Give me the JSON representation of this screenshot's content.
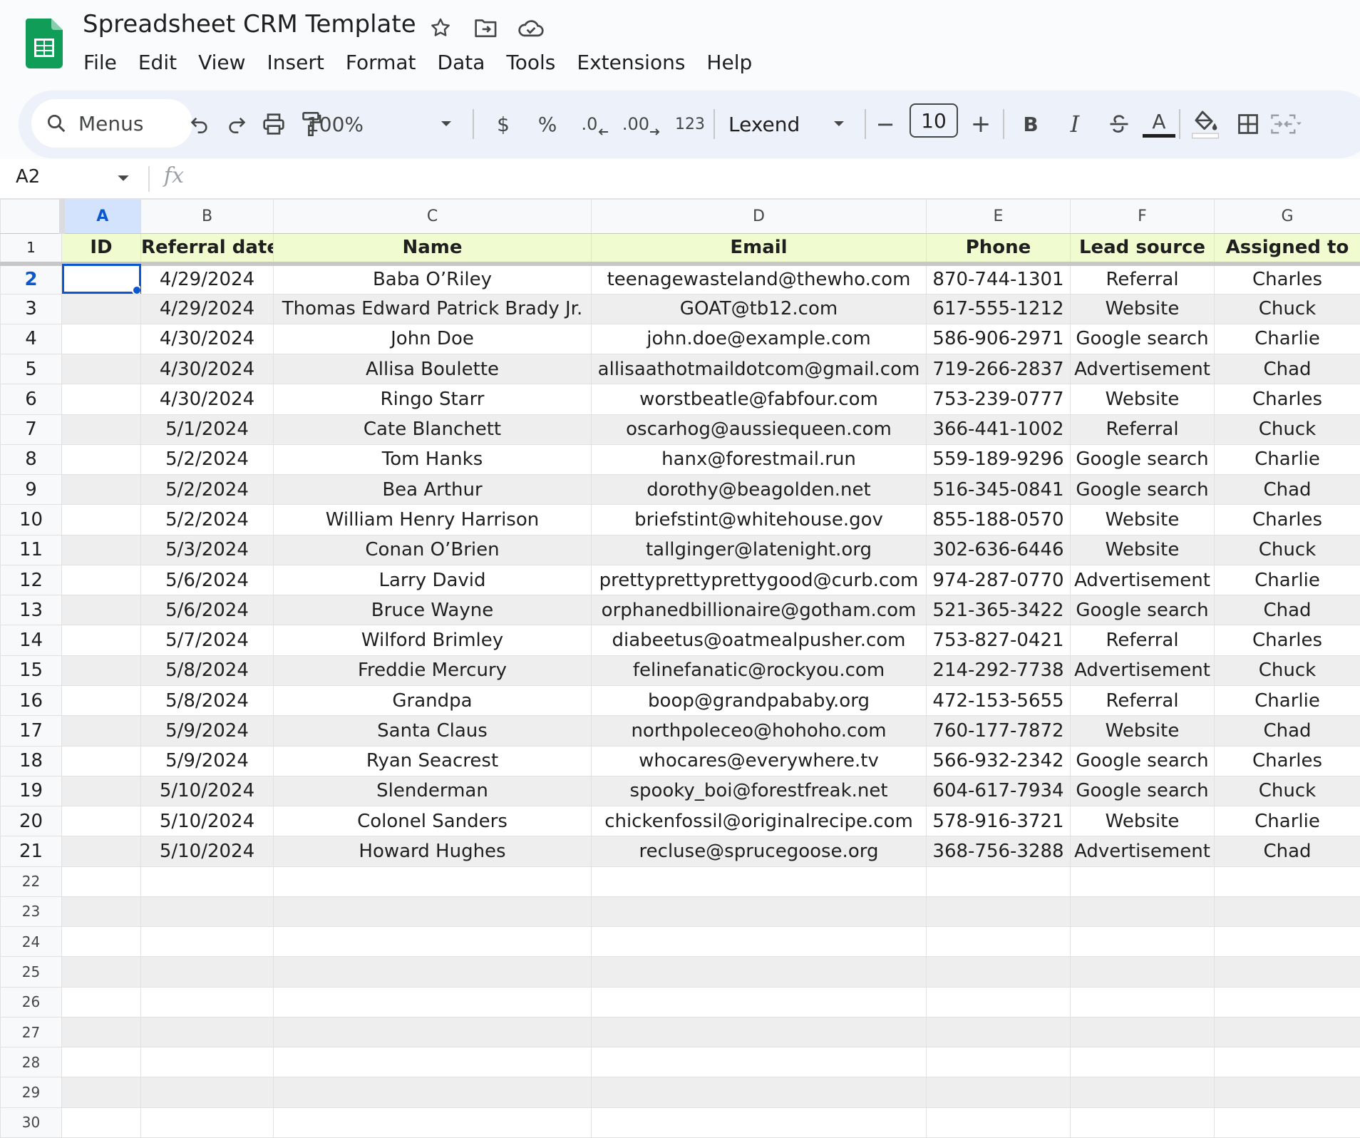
{
  "app": {
    "doc_title": "Spreadsheet CRM Template",
    "menus": [
      "File",
      "Edit",
      "View",
      "Insert",
      "Format",
      "Data",
      "Tools",
      "Extensions",
      "Help"
    ],
    "title_icons": [
      "star-icon",
      "move-to-folder-icon",
      "cloud-saved-icon"
    ]
  },
  "toolbar": {
    "search_label": "Menus",
    "zoom": "100%",
    "currency": "$",
    "percent": "%",
    "decrease_decimal": ".0",
    "increase_decimal": ".00",
    "number_format": "123",
    "font": "Lexend",
    "font_size": "10",
    "minus": "−",
    "plus": "+",
    "bold": "B",
    "italic": "I",
    "text_color": "A",
    "icons": [
      "undo-icon",
      "redo-icon",
      "print-icon",
      "paint-format-icon",
      "strikethrough-icon",
      "fill-color-icon",
      "borders-icon",
      "merge-cells-icon"
    ]
  },
  "formula_bar": {
    "cell_ref": "A2",
    "fx": "fx"
  },
  "sheet": {
    "column_letters": [
      "A",
      "B",
      "C",
      "D",
      "E",
      "F",
      "G"
    ],
    "selected_column": "A",
    "selected_row": "2",
    "headers": [
      "ID",
      "Referral date",
      "Name",
      "Email",
      "Phone",
      "Lead source",
      "Assigned to"
    ],
    "rows": [
      [
        "",
        "4/29/2024",
        "Baba O’Riley",
        "teenagewasteland@thewho.com",
        "870-744-1301",
        "Referral",
        "Charles"
      ],
      [
        "",
        "4/29/2024",
        "Thomas Edward Patrick Brady Jr.",
        "GOAT@tb12.com",
        "617-555-1212",
        "Website",
        "Chuck"
      ],
      [
        "",
        "4/30/2024",
        "John Doe",
        "john.doe@example.com",
        "586-906-2971",
        "Google search",
        "Charlie"
      ],
      [
        "",
        "4/30/2024",
        "Allisa Boulette",
        "allisaathotmaildotcom@gmail.com",
        "719-266-2837",
        "Advertisement",
        "Chad"
      ],
      [
        "",
        "4/30/2024",
        "Ringo Starr",
        "worstbeatle@fabfour.com",
        "753-239-0777",
        "Website",
        "Charles"
      ],
      [
        "",
        "5/1/2024",
        "Cate Blanchett",
        "oscarhog@aussiequeen.com",
        "366-441-1002",
        "Referral",
        "Chuck"
      ],
      [
        "",
        "5/2/2024",
        "Tom Hanks",
        "hanx@forestmail.run",
        "559-189-9296",
        "Google search",
        "Charlie"
      ],
      [
        "",
        "5/2/2024",
        "Bea Arthur",
        "dorothy@beagolden.net",
        "516-345-0841",
        "Google search",
        "Chad"
      ],
      [
        "",
        "5/2/2024",
        "William Henry Harrison",
        "briefstint@whitehouse.gov",
        "855-188-0570",
        "Website",
        "Charles"
      ],
      [
        "",
        "5/3/2024",
        "Conan O’Brien",
        "tallginger@latenight.org",
        "302-636-6446",
        "Website",
        "Chuck"
      ],
      [
        "",
        "5/6/2024",
        "Larry David",
        "prettyprettyprettygood@curb.com",
        "974-287-0770",
        "Advertisement",
        "Charlie"
      ],
      [
        "",
        "5/6/2024",
        "Bruce Wayne",
        "orphanedbillionaire@gotham.com",
        "521-365-3422",
        "Google search",
        "Chad"
      ],
      [
        "",
        "5/7/2024",
        "Wilford Brimley",
        "diabeetus@oatmealpusher.com",
        "753-827-0421",
        "Referral",
        "Charles"
      ],
      [
        "",
        "5/8/2024",
        "Freddie Mercury",
        "felinefanatic@rockyou.com",
        "214-292-7738",
        "Advertisement",
        "Chuck"
      ],
      [
        "",
        "5/8/2024",
        "Grandpa",
        "boop@grandpababy.org",
        "472-153-5655",
        "Referral",
        "Charlie"
      ],
      [
        "",
        "5/9/2024",
        "Santa Claus",
        "northpoleceo@hohoho.com",
        "760-177-7872",
        "Website",
        "Chad"
      ],
      [
        "",
        "5/9/2024",
        "Ryan Seacrest",
        "whocares@everywhere.tv",
        "566-932-2342",
        "Google search",
        "Charles"
      ],
      [
        "",
        "5/10/2024",
        "Slenderman",
        "spooky_boi@forestfreak.net",
        "604-617-7934",
        "Google search",
        "Chuck"
      ],
      [
        "",
        "5/10/2024",
        "Colonel Sanders",
        "chickenfossil@originalrecipe.com",
        "578-916-3721",
        "Website",
        "Charlie"
      ],
      [
        "",
        "5/10/2024",
        "Howard Hughes",
        "recluse@sprucegoose.org",
        "368-756-3288",
        "Advertisement",
        "Chad"
      ]
    ],
    "empty_row_numbers": [
      "22",
      "23",
      "24",
      "25",
      "26",
      "27",
      "28",
      "29",
      "30"
    ],
    "colors": {
      "header_fill": "#f0fccf",
      "band_fill": "#eeeeee",
      "selection": "#0b57d0",
      "selected_header": "#d3e3fd"
    }
  }
}
